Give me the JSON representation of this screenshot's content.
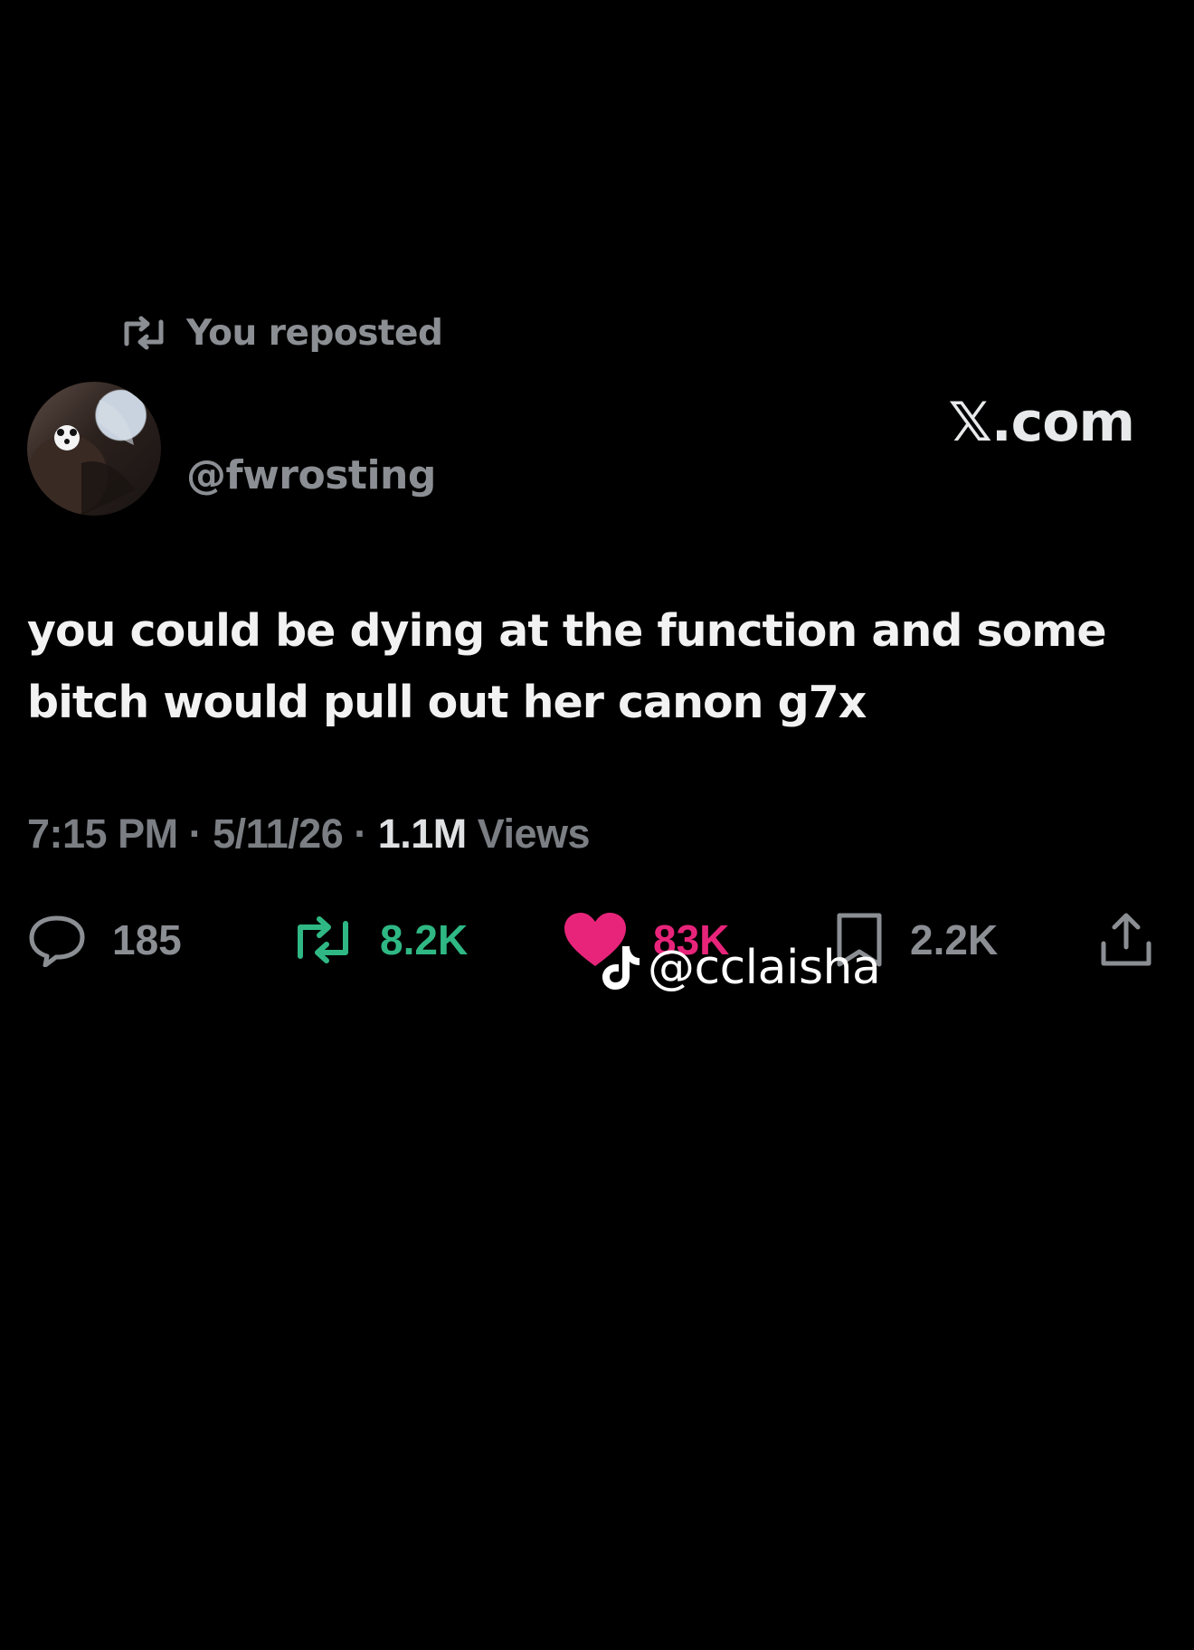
{
  "repost": {
    "label": "You reposted"
  },
  "author": {
    "handle": "@fwrosting"
  },
  "brand": {
    "label": "𝕏.com"
  },
  "tweet": {
    "line1": "you could be dying at the function and some",
    "line2": "bitch would pull out her canon g7x"
  },
  "meta": {
    "time": "7:15 PM",
    "date": "5/11/26",
    "dot": "·",
    "views_count": "1.1M",
    "views_label": "Views"
  },
  "actions": {
    "replies": "185",
    "reposts": "8.2K",
    "likes": "83K",
    "bookmarks": "2.2K"
  },
  "watermark": {
    "text": "@cclaisha"
  },
  "colors": {
    "background": "#000000",
    "repost_green": "#2fb884",
    "like_pink": "#e8247a",
    "muted_gray": "#8b8f94"
  },
  "icons": {
    "repost": "repost-icon",
    "reply": "reply-icon",
    "like": "heart-icon",
    "bookmark": "bookmark-icon",
    "share": "share-icon",
    "tiktok": "tiktok-icon"
  }
}
